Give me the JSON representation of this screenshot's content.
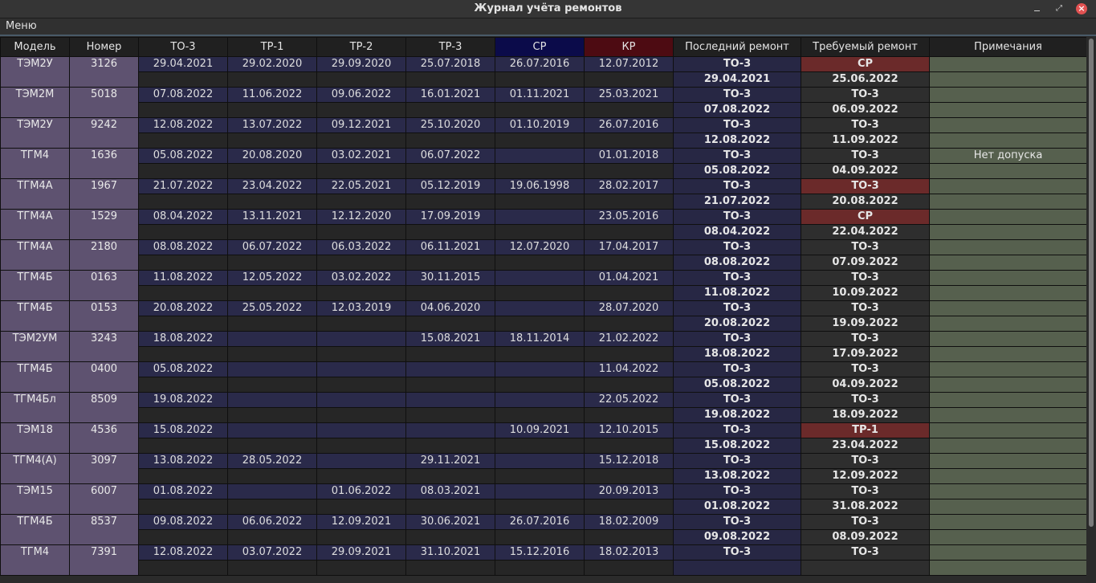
{
  "window": {
    "title": "Журнал учёта ремонтов"
  },
  "menu": {
    "label": "Меню"
  },
  "columns": [
    "Модель",
    "Номер",
    "ТО-3",
    "ТР-1",
    "ТР-2",
    "ТР-3",
    "СР",
    "КР",
    "Последний ремонт",
    "Требуемый ремонт",
    "Примечания"
  ],
  "rows": [
    {
      "model": "ТЭМ2У",
      "number": "3126",
      "to3": "29.04.2021",
      "tr1": "29.02.2020",
      "tr2": "29.09.2020",
      "tr3": "25.07.2018",
      "sr": "26.07.2016",
      "kr": "12.07.2012",
      "last_type": "ТО-3",
      "last_date": "29.04.2021",
      "req_type": "СР",
      "req_date": "25.06.2022",
      "req_alert": true,
      "note": ""
    },
    {
      "model": "ТЭМ2М",
      "number": "5018",
      "to3": "07.08.2022",
      "tr1": "11.06.2022",
      "tr2": "09.06.2022",
      "tr3": "16.01.2021",
      "sr": "01.11.2021",
      "kr": "25.03.2021",
      "last_type": "ТО-3",
      "last_date": "07.08.2022",
      "req_type": "ТО-3",
      "req_date": "06.09.2022",
      "req_alert": false,
      "note": ""
    },
    {
      "model": "ТЭМ2У",
      "number": "9242",
      "to3": "12.08.2022",
      "tr1": "13.07.2022",
      "tr2": "09.12.2021",
      "tr3": "25.10.2020",
      "sr": "01.10.2019",
      "kr": "26.07.2016",
      "last_type": "ТО-3",
      "last_date": "12.08.2022",
      "req_type": "ТО-3",
      "req_date": "11.09.2022",
      "req_alert": false,
      "note": ""
    },
    {
      "model": "ТГМ4",
      "number": "1636",
      "to3": "05.08.2022",
      "tr1": "20.08.2020",
      "tr2": "03.02.2021",
      "tr3": "06.07.2022",
      "sr": "",
      "kr": "01.01.2018",
      "last_type": "ТО-3",
      "last_date": "05.08.2022",
      "req_type": "ТО-3",
      "req_date": "04.09.2022",
      "req_alert": false,
      "note": "Нет допуска"
    },
    {
      "model": "ТГМ4А",
      "number": "1967",
      "to3": "21.07.2022",
      "tr1": "23.04.2022",
      "tr2": "22.05.2021",
      "tr3": "05.12.2019",
      "sr": "19.06.1998",
      "kr": "28.02.2017",
      "last_type": "ТО-3",
      "last_date": "21.07.2022",
      "req_type": "ТО-3",
      "req_date": "20.08.2022",
      "req_alert": true,
      "note": ""
    },
    {
      "model": "ТГМ4А",
      "number": "1529",
      "to3": "08.04.2022",
      "tr1": "13.11.2021",
      "tr2": "12.12.2020",
      "tr3": "17.09.2019",
      "sr": "",
      "kr": "23.05.2016",
      "last_type": "ТО-3",
      "last_date": "08.04.2022",
      "req_type": "СР",
      "req_date": "22.04.2022",
      "req_alert": true,
      "note": ""
    },
    {
      "model": "ТГМ4А",
      "number": "2180",
      "to3": "08.08.2022",
      "tr1": "06.07.2022",
      "tr2": "06.03.2022",
      "tr3": "06.11.2021",
      "sr": "12.07.2020",
      "kr": "17.04.2017",
      "last_type": "ТО-3",
      "last_date": "08.08.2022",
      "req_type": "ТО-3",
      "req_date": "07.09.2022",
      "req_alert": false,
      "note": ""
    },
    {
      "model": "ТГМ4Б",
      "number": "0163",
      "to3": "11.08.2022",
      "tr1": "12.05.2022",
      "tr2": "03.02.2022",
      "tr3": "30.11.2015",
      "sr": "",
      "kr": "01.04.2021",
      "last_type": "ТО-3",
      "last_date": "11.08.2022",
      "req_type": "ТО-3",
      "req_date": "10.09.2022",
      "req_alert": false,
      "note": ""
    },
    {
      "model": "ТГМ4Б",
      "number": "0153",
      "to3": "20.08.2022",
      "tr1": "25.05.2022",
      "tr2": "12.03.2019",
      "tr3": "04.06.2020",
      "sr": "",
      "kr": "28.07.2020",
      "last_type": "ТО-3",
      "last_date": "20.08.2022",
      "req_type": "ТО-3",
      "req_date": "19.09.2022",
      "req_alert": false,
      "note": ""
    },
    {
      "model": "ТЭМ2УМ",
      "number": "3243",
      "to3": "18.08.2022",
      "tr1": "",
      "tr2": "",
      "tr3": "15.08.2021",
      "sr": "18.11.2014",
      "kr": "21.02.2022",
      "last_type": "ТО-3",
      "last_date": "18.08.2022",
      "req_type": "ТО-3",
      "req_date": "17.09.2022",
      "req_alert": false,
      "note": ""
    },
    {
      "model": "ТГМ4Б",
      "number": "0400",
      "to3": "05.08.2022",
      "tr1": "",
      "tr2": "",
      "tr3": "",
      "sr": "",
      "kr": "11.04.2022",
      "last_type": "ТО-3",
      "last_date": "05.08.2022",
      "req_type": "ТО-3",
      "req_date": "04.09.2022",
      "req_alert": false,
      "note": ""
    },
    {
      "model": "ТГМ4Бл",
      "number": "8509",
      "to3": "19.08.2022",
      "tr1": "",
      "tr2": "",
      "tr3": "",
      "sr": "",
      "kr": "22.05.2022",
      "last_type": "ТО-3",
      "last_date": "19.08.2022",
      "req_type": "ТО-3",
      "req_date": "18.09.2022",
      "req_alert": false,
      "note": ""
    },
    {
      "model": "ТЭМ18",
      "number": "4536",
      "to3": "15.08.2022",
      "tr1": "",
      "tr2": "",
      "tr3": "",
      "sr": "10.09.2021",
      "kr": "12.10.2015",
      "last_type": "ТО-3",
      "last_date": "15.08.2022",
      "req_type": "ТР-1",
      "req_date": "23.04.2022",
      "req_alert": true,
      "note": ""
    },
    {
      "model": "ТГМ4(А)",
      "number": "3097",
      "to3": "13.08.2022",
      "tr1": "28.05.2022",
      "tr2": "",
      "tr3": "29.11.2021",
      "sr": "",
      "kr": "15.12.2018",
      "last_type": "ТО-3",
      "last_date": "13.08.2022",
      "req_type": "ТО-3",
      "req_date": "12.09.2022",
      "req_alert": false,
      "note": ""
    },
    {
      "model": "ТЭМ15",
      "number": "6007",
      "to3": "01.08.2022",
      "tr1": "",
      "tr2": "01.06.2022",
      "tr3": "08.03.2021",
      "sr": "",
      "kr": "20.09.2013",
      "last_type": "ТО-3",
      "last_date": "01.08.2022",
      "req_type": "ТО-3",
      "req_date": "31.08.2022",
      "req_alert": false,
      "note": ""
    },
    {
      "model": "ТГМ4Б",
      "number": "8537",
      "to3": "09.08.2022",
      "tr1": "06.06.2022",
      "tr2": "12.09.2021",
      "tr3": "30.06.2021",
      "sr": "26.07.2016",
      "kr": "18.02.2009",
      "last_type": "ТО-3",
      "last_date": "09.08.2022",
      "req_type": "ТО-3",
      "req_date": "08.09.2022",
      "req_alert": false,
      "note": ""
    },
    {
      "model": "ТГМ4",
      "number": "7391",
      "to3": "12.08.2022",
      "tr1": "03.07.2022",
      "tr2": "29.09.2021",
      "tr3": "31.10.2021",
      "sr": "15.12.2016",
      "kr": "18.02.2013",
      "last_type": "ТО-3",
      "last_date": "",
      "req_type": "ТО-3",
      "req_date": "",
      "req_alert": false,
      "note": ""
    }
  ]
}
